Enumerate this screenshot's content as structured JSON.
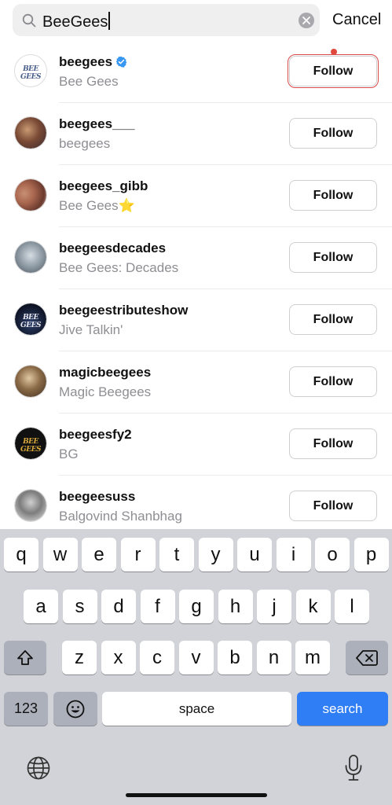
{
  "search": {
    "query": "BeeGees",
    "cancel_label": "Cancel"
  },
  "results": [
    {
      "username": "beegees",
      "fullname": "Bee Gees",
      "verified": true,
      "follow_label": "Follow",
      "avatar_style": "logo-light",
      "avatar_text": "BEE GEES"
    },
    {
      "username": "beegees___",
      "fullname": "beegees",
      "verified": false,
      "follow_label": "Follow",
      "avatar_style": "photo-warm"
    },
    {
      "username": "beegees_gibb",
      "fullname": "Bee Gees⭐",
      "verified": false,
      "follow_label": "Follow",
      "avatar_style": "photo-faces"
    },
    {
      "username": "beegeesdecades",
      "fullname": "Bee Gees: Decades",
      "verified": false,
      "follow_label": "Follow",
      "avatar_style": "photo-bw"
    },
    {
      "username": "beegeestributeshow",
      "fullname": "Jive Talkin'",
      "verified": false,
      "follow_label": "Follow",
      "avatar_style": "logo-dark",
      "avatar_text": "BEE GEES"
    },
    {
      "username": "magicbeegees",
      "fullname": "Magic Beegees",
      "verified": false,
      "follow_label": "Follow",
      "avatar_style": "photo-sepia"
    },
    {
      "username": "beegeesfy2",
      "fullname": "BG",
      "verified": false,
      "follow_label": "Follow",
      "avatar_style": "logo-gold",
      "avatar_text": "BEE GEES"
    },
    {
      "username": "beegeesuss",
      "fullname": "Balgovind Shanbhag",
      "verified": false,
      "follow_label": "Follow",
      "avatar_style": "photo-gray"
    }
  ],
  "keyboard": {
    "row1": [
      "q",
      "w",
      "e",
      "r",
      "t",
      "y",
      "u",
      "i",
      "o",
      "p"
    ],
    "row2": [
      "a",
      "s",
      "d",
      "f",
      "g",
      "h",
      "j",
      "k",
      "l"
    ],
    "row3": [
      "z",
      "x",
      "c",
      "v",
      "b",
      "n",
      "m"
    ],
    "numbers_label": "123",
    "space_label": "space",
    "search_label": "search"
  },
  "colors": {
    "accent": "#2f7ef6",
    "verified": "#3897f0",
    "notification": "#e0483c",
    "keyboard_bg": "#d1d3d9"
  }
}
